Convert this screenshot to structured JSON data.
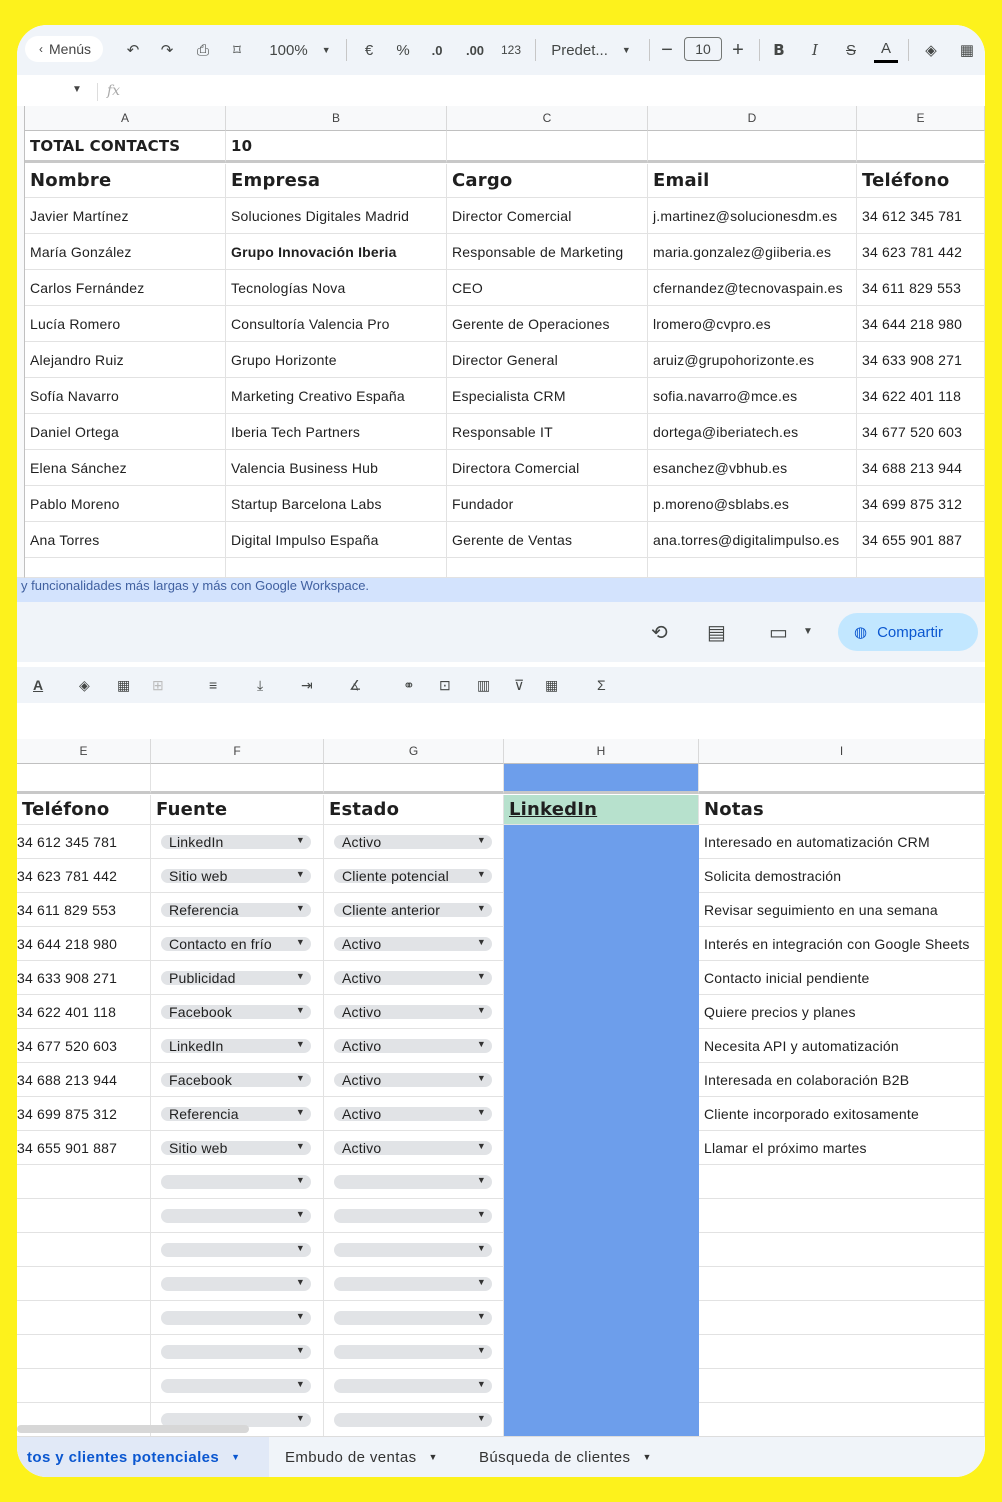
{
  "toolbar": {
    "menus_label": "Menús",
    "zoom": "100%",
    "currency": "€",
    "percent": "%",
    "dec_less": ".0",
    "dec_more": ".00",
    "format_num": "123",
    "font": "Predet...",
    "font_size": "10",
    "bold": "B",
    "italic": "I",
    "text_color": "A"
  },
  "formula_bar": {
    "fx": "fx"
  },
  "sheet1": {
    "columns": [
      "A",
      "B",
      "C",
      "D",
      "E"
    ],
    "total_label": "TOTAL CONTACTS",
    "total_value": "10",
    "headers": [
      "Nombre",
      "Empresa",
      "Cargo",
      "Email",
      "Teléfono"
    ],
    "rows": [
      [
        "Javier Martínez",
        "Soluciones Digitales Madrid",
        "Director Comercial",
        "j.martinez@solucionesdm.es",
        "34 612 345 781"
      ],
      [
        "María González",
        "Grupo Innovación Iberia",
        "Responsable de Marketing",
        "maria.gonzalez@giiberia.es",
        "34 623 781 442"
      ],
      [
        "Carlos Fernández",
        "Tecnologías Nova",
        "CEO",
        "cfernandez@tecnovaspain.es",
        "34 611 829 553"
      ],
      [
        "Lucía Romero",
        "Consultoría Valencia Pro",
        "Gerente de Operaciones",
        "lromero@cvpro.es",
        "34 644 218 980"
      ],
      [
        "Alejandro Ruiz",
        "Grupo Horizonte",
        "Director General",
        "aruiz@grupohorizonte.es",
        "34 633 908 271"
      ],
      [
        "Sofía Navarro",
        "Marketing Creativo España",
        "Especialista CRM",
        "sofia.navarro@mce.es",
        "34 622 401 118"
      ],
      [
        "Daniel Ortega",
        "Iberia Tech Partners",
        "Responsable IT",
        "dortega@iberiatech.es",
        "34 677 520 603"
      ],
      [
        "Elena Sánchez",
        "Valencia Business Hub",
        "Directora Comercial",
        "esanchez@vbhub.es",
        "34 688 213 944"
      ],
      [
        "Pablo Moreno",
        "Startup Barcelona Labs",
        "Fundador",
        "p.moreno@sblabs.es",
        "34 699 875 312"
      ],
      [
        "Ana Torres",
        "Digital Impulso España",
        "Gerente de Ventas",
        "ana.torres@digitalimpulso.es",
        "34 655 901 887"
      ]
    ]
  },
  "banner_text": "y funcionalidades más largas y más con Google Workspace.",
  "share_label": "Compartir",
  "sheet2": {
    "columns": [
      "E",
      "F",
      "G",
      "H",
      "I"
    ],
    "headers": [
      "Teléfono",
      "Fuente",
      "Estado",
      "LinkedIn",
      "Notas"
    ],
    "rows": [
      [
        "34 612 345 781",
        "LinkedIn",
        "Activo",
        "Interesado en automatización CRM"
      ],
      [
        "34 623 781 442",
        "Sitio web",
        "Cliente potencial",
        "Solicita demostración"
      ],
      [
        "34 611 829 553",
        "Referencia",
        "Cliente anterior",
        "Revisar seguimiento en una semana"
      ],
      [
        "34 644 218 980",
        "Contacto en frío",
        "Activo",
        "Interés en integración con Google Sheets"
      ],
      [
        "34 633 908 271",
        "Publicidad",
        "Activo",
        "Contacto inicial pendiente"
      ],
      [
        "34 622 401 118",
        "Facebook",
        "Activo",
        "Quiere precios y planes"
      ],
      [
        "34 677 520 603",
        "LinkedIn",
        "Activo",
        "Necesita API y automatización"
      ],
      [
        "34 688 213 944",
        "Facebook",
        "Activo",
        "Interesada en colaboración B2B"
      ],
      [
        "34 699 875 312",
        "Referencia",
        "Activo",
        "Cliente incorporado exitosamente"
      ],
      [
        "34 655 901 887",
        "Sitio web",
        "Activo",
        "Llamar el próximo martes"
      ]
    ],
    "empty_rows": 8
  },
  "tabs": [
    "tos y clientes potenciales",
    "Embudo de ventas",
    "Búsqueda de clientes"
  ],
  "colors": {
    "accent": "#0b57d0",
    "linkedin_fill": "#6d9eeb",
    "linkedin_header": "#b7e1cd",
    "frame": "#fdf21c"
  }
}
